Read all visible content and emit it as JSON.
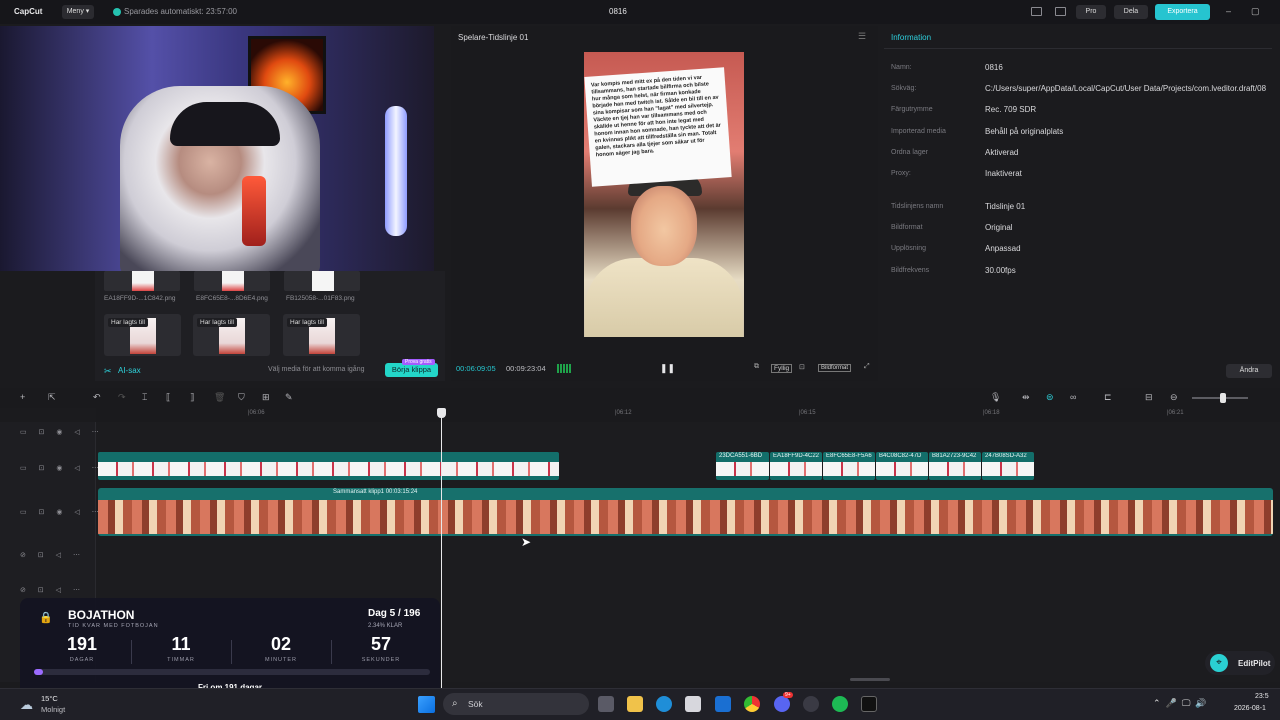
{
  "app": {
    "logo": "CapCut",
    "menu": "Meny",
    "autosave": "Sparades automatiskt: 23:57:00",
    "project": "0816",
    "pro": "Pro",
    "share": "Dela",
    "export": "Exportera"
  },
  "media": {
    "files": [
      {
        "name": "EA18FF9D-...1C842.png"
      },
      {
        "name": "E8FC65E8-...8D6E4.png"
      },
      {
        "name": "FB125058-...01F83.png"
      }
    ],
    "cards": [
      {
        "tag": "Har lagts till"
      },
      {
        "tag": "Har lagts till"
      },
      {
        "tag": "Har lagts till"
      }
    ],
    "ai_sax": "AI-sax",
    "hint": "Välj media för att komma igång",
    "start_cut": "Börja klippa",
    "free_badge": "Prova gratis"
  },
  "player": {
    "title": "Spelare-Tidslinje 01",
    "caption": "Var kompis med mitt ex på den tiden vi var tillsammans, han startade billfirma och bilste hur många som helst, när firman konkade började han med twitch ist. Sålde en bil till en av sina kompisar som han \"lagat\" med silvertejp. Väckte en tjej han var tillsammans med och skällde ut henne för att hon inte legat med honom innan hon somnade, han tyckte att det är en kvinnas plikt att tillfredställa sin man. Totalt galen, stackars alla tjejer som säkar ut för honom säger jag bara.",
    "timecode": "00:06:09:05",
    "duration": "00:09:23:04",
    "fit": "Fyllig",
    "ratio": "Bildformat"
  },
  "info": {
    "title": "Information",
    "rows": [
      {
        "label": "Namn:",
        "value": "0816"
      },
      {
        "label": "Sökväg:",
        "value": "C:/Users/super/AppData/Local/CapCut/User Data/Projects/com.lveditor.draft/08"
      },
      {
        "label": "Färgutrymme",
        "value": "Rec. 709 SDR"
      },
      {
        "label": "Importerad media",
        "value": "Behåll på originalplats"
      },
      {
        "label": "Ordna lager",
        "value": "Aktiverad"
      },
      {
        "label": "Proxy:",
        "value": "Inaktiverat"
      },
      {
        "label": "Tidslinjens namn",
        "value": "Tidslinje 01"
      },
      {
        "label": "Bildformat",
        "value": "Original"
      },
      {
        "label": "Upplösning",
        "value": "Anpassad"
      },
      {
        "label": "Bildfrekvens",
        "value": "30.00fps"
      }
    ],
    "change": "Ändra"
  },
  "timeline": {
    "ticks": [
      "|06:06",
      "|06:12",
      "|06:15",
      "|06:18",
      "|06:21"
    ],
    "top_clips": [
      "23DCA551-6BD",
      "EA18FF9D-4C22",
      "E8FC65E8-F5A6",
      "B4C08C82-47D",
      "B81A2723-9C42",
      "247B08SD-A32"
    ],
    "compound": "Sammansatt klipp1  00:03:15:24"
  },
  "overlay": {
    "title": "BOJATHON",
    "subtitle": "TID KVAR MED FOTBOJAN",
    "day": "Dag 5 / 196",
    "pct_label": "2.34% KLAR",
    "progress": 0.0234,
    "units": [
      {
        "num": "191",
        "unit": "DAGAR"
      },
      {
        "num": "11",
        "unit": "TIMMAR"
      },
      {
        "num": "02",
        "unit": "MINUTER"
      },
      {
        "num": "57",
        "unit": "SEKUNDER"
      }
    ],
    "footer": "Fri om 191 dagar"
  },
  "editpilot": "EditPilot",
  "taskbar": {
    "temp": "15°C",
    "cond": "Molnigt",
    "search": "Sök",
    "time": "23:5",
    "date": "2026-08-1",
    "badge": "9+"
  }
}
